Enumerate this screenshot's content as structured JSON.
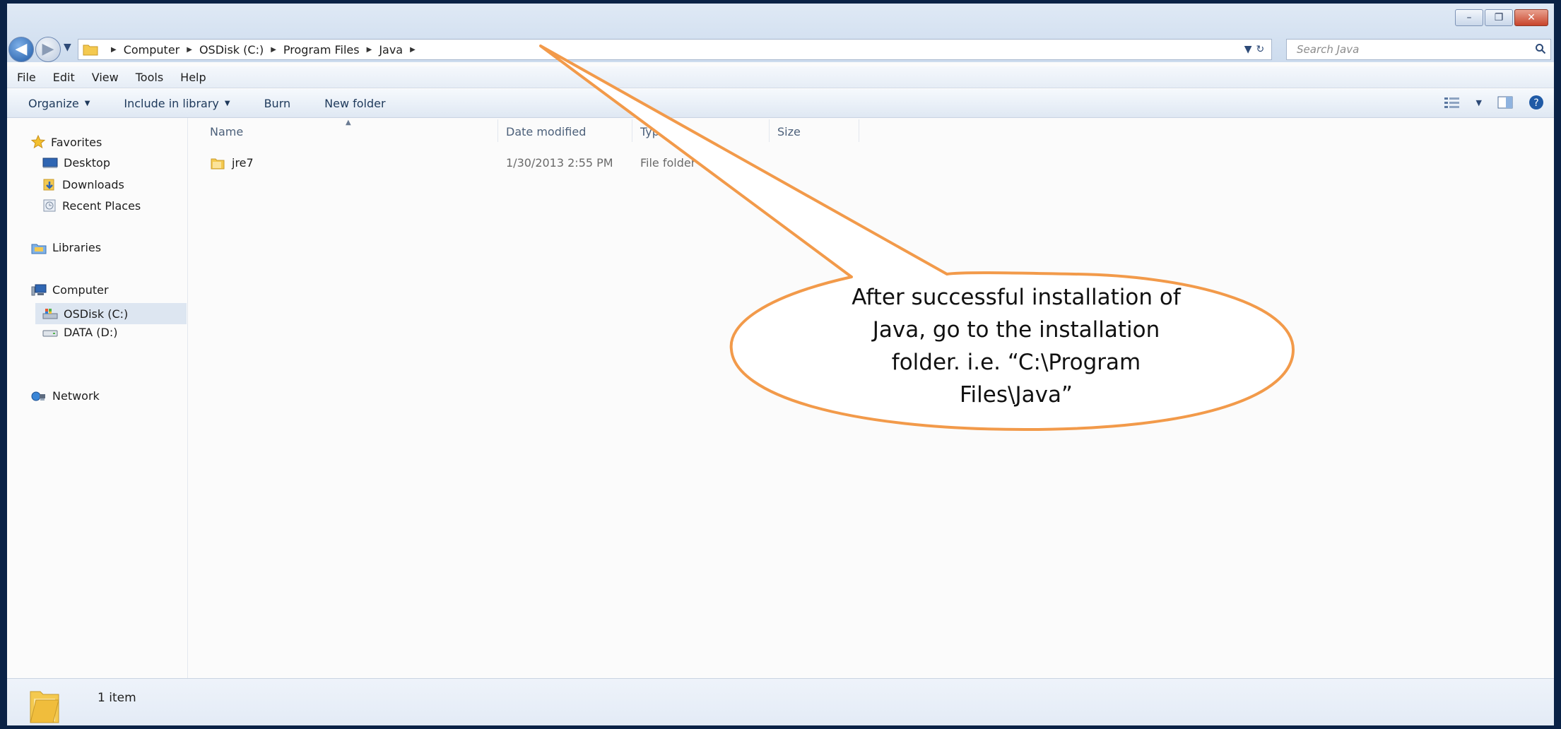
{
  "address_bar": {
    "breadcrumbs": [
      "Computer",
      "OSDisk (C:)",
      "Program Files",
      "Java"
    ]
  },
  "search": {
    "placeholder": "Search Java"
  },
  "menu": [
    "File",
    "Edit",
    "View",
    "Tools",
    "Help"
  ],
  "toolbar": {
    "organize": "Organize",
    "include_in_library": "Include in library",
    "burn": "Burn",
    "new_folder": "New folder"
  },
  "nav": {
    "favorites": "Favorites",
    "desktop": "Desktop",
    "downloads": "Downloads",
    "recent_places": "Recent Places",
    "libraries": "Libraries",
    "computer": "Computer",
    "osdisk": "OSDisk (C:)",
    "data": "DATA (D:)",
    "network": "Network"
  },
  "columns": {
    "name": "Name",
    "date_modified": "Date modified",
    "type": "Type",
    "size": "Size"
  },
  "files": [
    {
      "name": "jre7",
      "date_modified": "1/30/2013 2:55 PM",
      "type": "File folder",
      "size": ""
    }
  ],
  "status": {
    "count": "1 item"
  },
  "callout": {
    "lines": [
      "After successful installation of",
      "Java, go to the installation",
      "folder. i.e. “C:\\Program",
      "Files\\Java”"
    ]
  },
  "colors": {
    "callout_border": "#f29a4a",
    "window_frame": "#0a2246"
  }
}
